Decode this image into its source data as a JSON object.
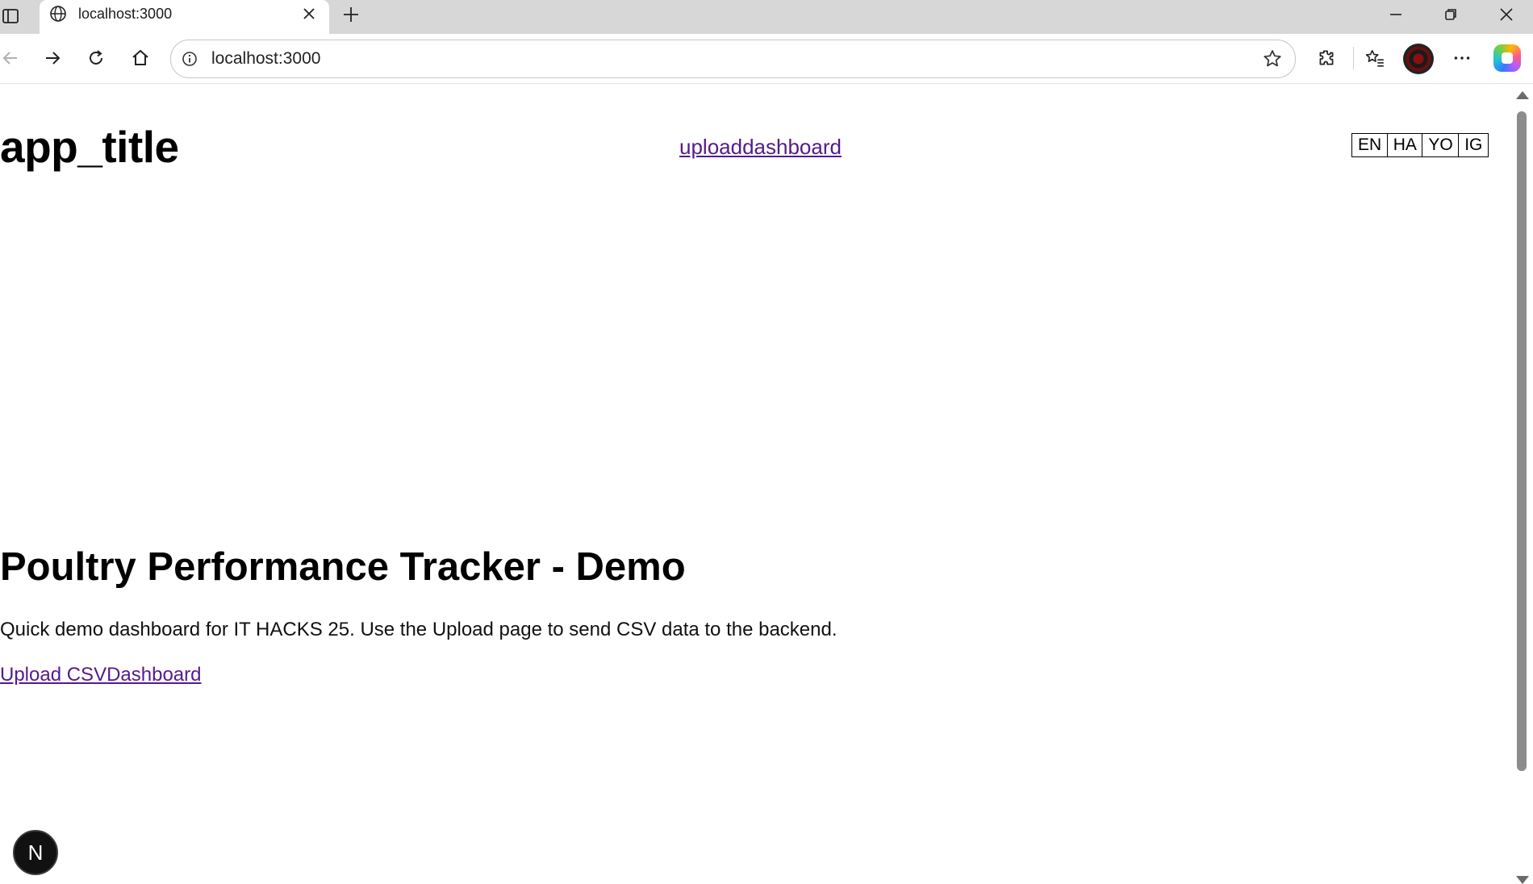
{
  "browser": {
    "tab_title": "localhost:3000",
    "url": "localhost:3000",
    "icons": [
      "sidebar-toggle-icon",
      "globe-icon",
      "close-icon",
      "plus-icon",
      "minimize-icon",
      "restore-icon",
      "back-icon",
      "forward-icon",
      "reload-icon",
      "home-icon",
      "info-icon",
      "star-icon",
      "extensions-icon",
      "favorites-icon",
      "more-icon",
      "copilot-icon"
    ]
  },
  "header": {
    "app_title": "app_title",
    "nav_link": "uploaddashboard",
    "languages": [
      "EN",
      "HA",
      "YO",
      "IG"
    ]
  },
  "main": {
    "heading": "Poultry Performance Tracker - Demo",
    "description": "Quick demo dashboard for IT HACKS 25. Use the Upload page to send CSV data to the backend.",
    "upload_link": "Upload CSV",
    "dashboard_link": "Dashboard"
  },
  "devtools_badge": "N",
  "colors": {
    "link": "#551a8b",
    "tabbar": "#d7d7d7"
  }
}
